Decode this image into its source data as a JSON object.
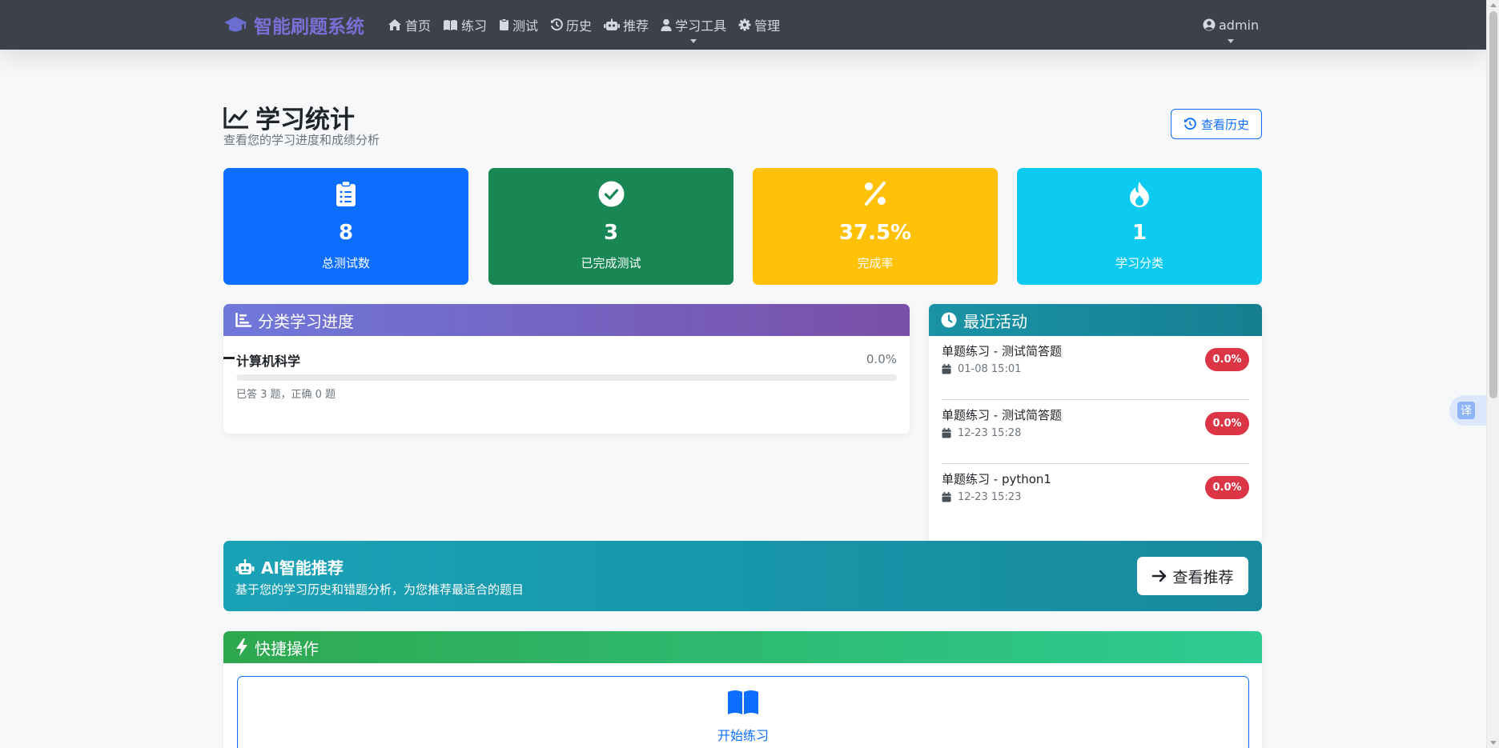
{
  "navbar": {
    "brand": "智能刷题系统",
    "items": [
      {
        "label": "首页",
        "icon": "home-icon"
      },
      {
        "label": "练习",
        "icon": "book-icon"
      },
      {
        "label": "测试",
        "icon": "clipboard-icon"
      },
      {
        "label": "历史",
        "icon": "history-icon"
      },
      {
        "label": "推荐",
        "icon": "robot-icon"
      },
      {
        "label": "学习工具",
        "icon": "user-icon"
      },
      {
        "label": "管理",
        "icon": "gear-icon"
      }
    ],
    "user": "admin"
  },
  "header": {
    "title": "学习统计",
    "subtitle": "查看您的学习进度和成绩分析",
    "history_button": "查看历史"
  },
  "stats": [
    {
      "value": "8",
      "label": "总测试数",
      "color": "#0d6efd",
      "icon": "clipboard-list-icon"
    },
    {
      "value": "3",
      "label": "已完成测试",
      "color": "#198754",
      "icon": "check-circle-icon"
    },
    {
      "value": "37.5%",
      "label": "完成率",
      "color": "#ffc107",
      "icon": "percent-icon"
    },
    {
      "value": "1",
      "label": "学习分类",
      "color": "#0dcaf0",
      "icon": "fire-icon"
    }
  ],
  "category_progress": {
    "title": "分类学习进度",
    "items": [
      {
        "name": "计算机科学",
        "percent": "0.0%",
        "fill": 0,
        "stats": "已答 3 题，正确 0 题"
      }
    ]
  },
  "recent_activity": {
    "title": "最近活动",
    "items": [
      {
        "title": "单题练习 - 测试简答题",
        "time": "01-08 15:01",
        "score": "0.0%"
      },
      {
        "title": "单题练习 - 测试简答题",
        "time": "12-23 15:28",
        "score": "0.0%"
      },
      {
        "title": "单题练习 - python1",
        "time": "12-23 15:23",
        "score": "0.0%"
      }
    ]
  },
  "ai_recommend": {
    "title": "AI智能推荐",
    "description": "基于您的学习历史和错题分析，为您推荐最适合的题目",
    "button": "查看推荐"
  },
  "quick_actions": {
    "title": "快捷操作",
    "start_practice": "开始练习"
  },
  "translate": "译"
}
